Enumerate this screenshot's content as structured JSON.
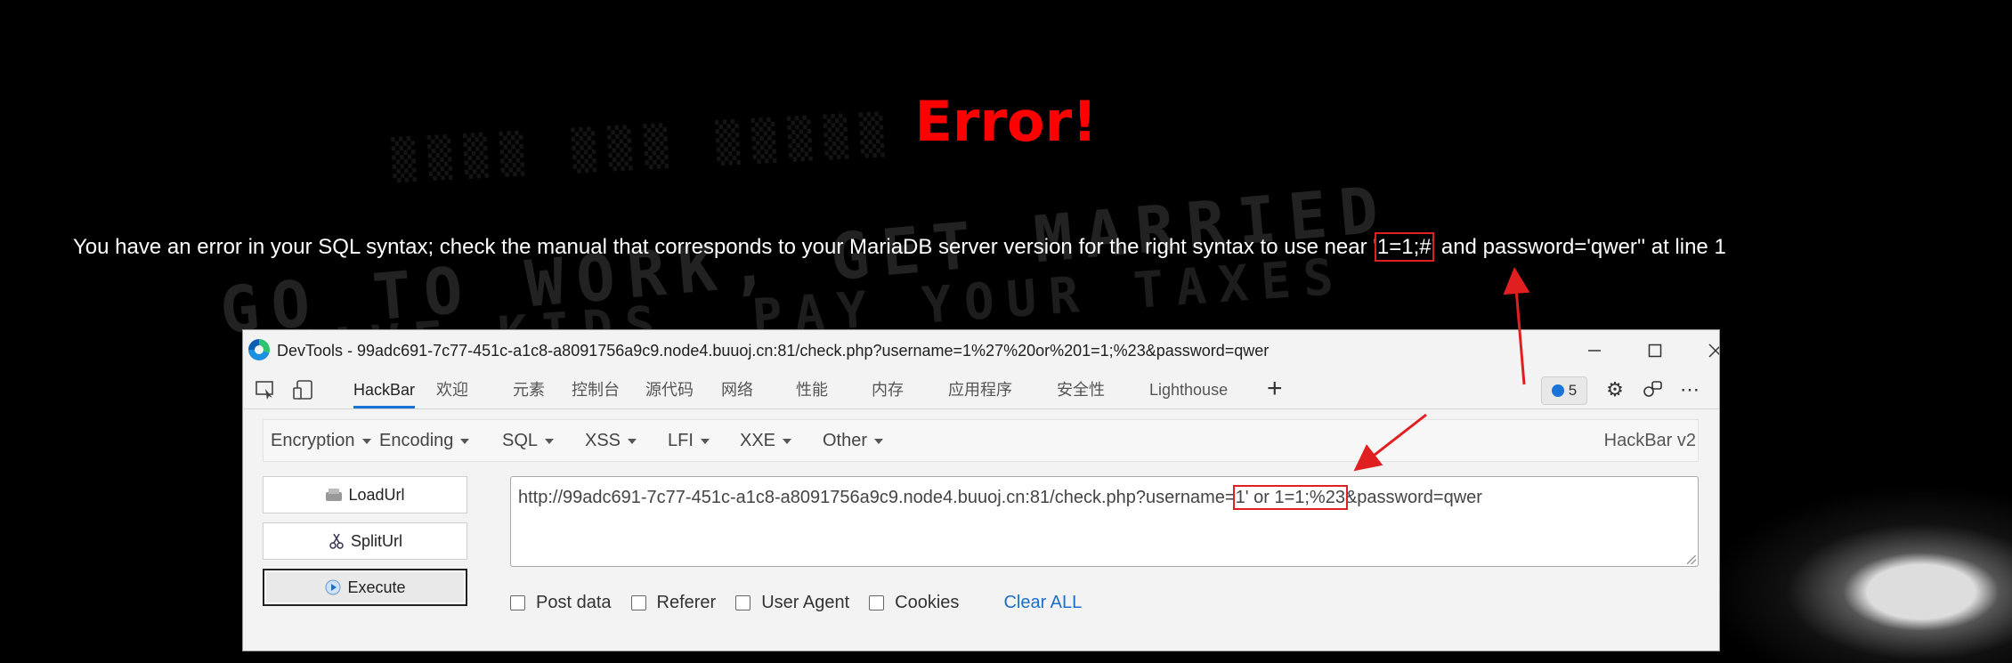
{
  "page": {
    "background_text": [
      "GO TO WORK, GET MARRIED",
      "HAVE KIDS, PAY YOUR TAXES"
    ],
    "error_title": "Error!",
    "error_message": {
      "prefix": "You have an error in your SQL syntax; check the manual that corresponds to your MariaDB server version for the right syntax to use near '",
      "highlight": "1=1;#",
      "suffix": "' and password='qwer'' at line 1"
    }
  },
  "devtools": {
    "title": "DevTools - 99adc691-7c77-451c-a1c8-a8091756a9c9.node4.buuoj.cn:81/check.php?username=1%27%20or%201=1;%23&password=qwer",
    "tabs": [
      "HackBar",
      "欢迎",
      "元素",
      "控制台",
      "源代码",
      "网络",
      "性能",
      "内存",
      "应用程序",
      "安全性",
      "Lighthouse"
    ],
    "active_tab": "HackBar",
    "issues_count": "5",
    "hackbar": {
      "menu": [
        "Encryption",
        "Encoding",
        "SQL",
        "XSS",
        "LFI",
        "XXE",
        "Other"
      ],
      "brand": "HackBar v2",
      "buttons": [
        "LoadUrl",
        "SplitUrl",
        "Execute"
      ],
      "url": {
        "prefix": "http://99adc691-7c77-451c-a1c8-a8091756a9c9.node4.buuoj.cn:81/check.php?username=",
        "highlight": "1' or 1=1;%23",
        "suffix": "&password=qwer"
      },
      "options": [
        "Post data",
        "Referer",
        "User Agent",
        "Cookies"
      ],
      "clear_label": "Clear ALL"
    }
  },
  "colors": {
    "error_title": "#ff0000",
    "annotation": "#e02020",
    "tab_underline": "#1a73d9",
    "clear_link": "#1a6fc9"
  }
}
